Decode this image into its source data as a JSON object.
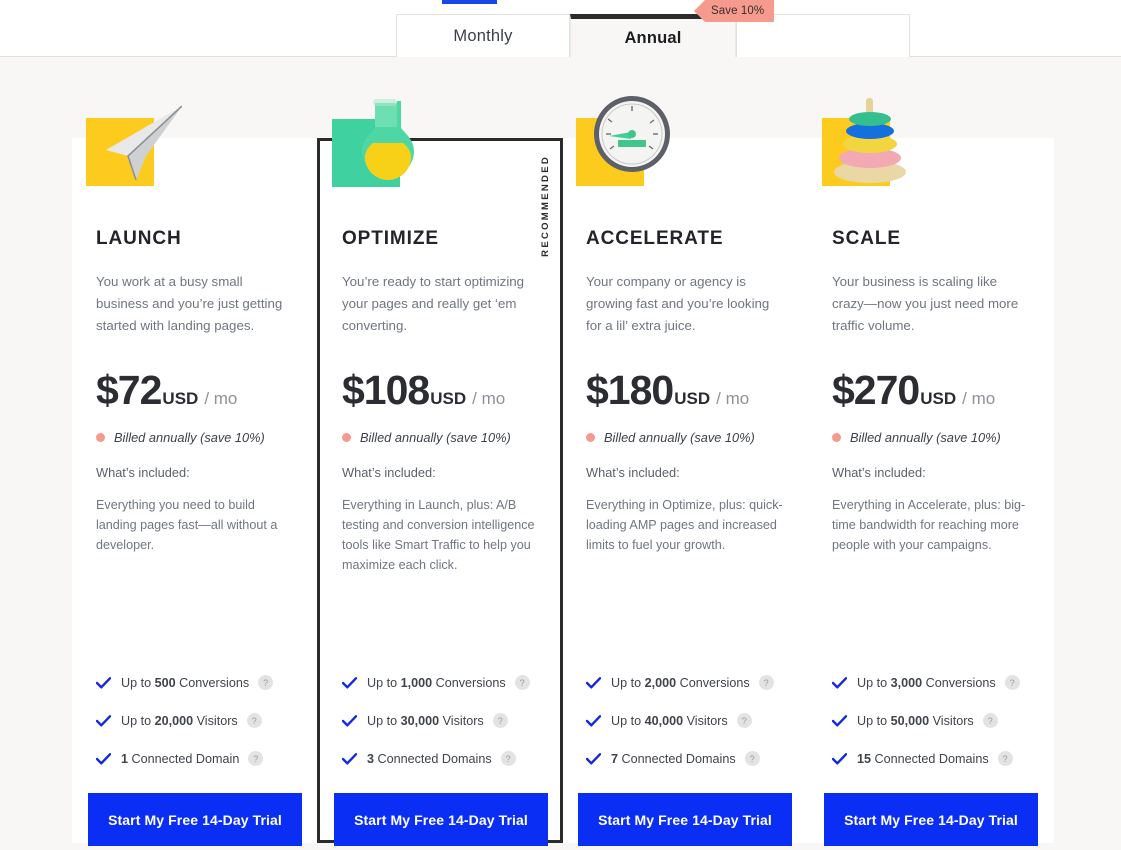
{
  "billing_tabs": {
    "monthly_label": "Monthly",
    "annual_label": "Annual",
    "active": "Annual",
    "save_badge": "Save 10%",
    "accent_blue": "#1447e6",
    "badge_color": "#f79a8e"
  },
  "plans": [
    {
      "name": "LAUNCH",
      "icon": "paper-plane-icon",
      "swatch_color": "#fdcb1e",
      "recommended": "",
      "description": "You work at a busy small business and you’re just getting started with landing pages.",
      "price_amount": "$72",
      "price_currency": "USD",
      "price_period": "/ mo",
      "billed_note": "Billed annually (save 10%)",
      "included_label": "What’s included:",
      "included_text": "Everything you need to build landing pages fast—all without a developer.",
      "features": [
        {
          "prefix": "Up to ",
          "value": "500",
          "suffix": " Conversions",
          "help": "?"
        },
        {
          "prefix": "Up to ",
          "value": "20,000",
          "suffix": " Visitors",
          "help": "?"
        },
        {
          "prefix": "",
          "value": "1",
          "suffix": " Connected Domain",
          "help": "?"
        }
      ],
      "cta_label": "Start My Free 14-Day Trial"
    },
    {
      "name": "OPTIMIZE",
      "icon": "flask-icon",
      "swatch_color": "#3fd2a0",
      "recommended": "RECOMMENDED",
      "description": "You’re ready to start optimizing your pages and really get ‘em converting.",
      "price_amount": "$108",
      "price_currency": "USD",
      "price_period": "/ mo",
      "billed_note": "Billed annually (save 10%)",
      "included_label": "What’s included:",
      "included_text": "Everything in Launch, plus: A/B testing and conversion intelligence tools like Smart Traffic to help you maximize each click.",
      "features": [
        {
          "prefix": "Up to ",
          "value": "1,000",
          "suffix": " Conversions",
          "help": "?"
        },
        {
          "prefix": "Up to ",
          "value": "30,000",
          "suffix": " Visitors",
          "help": "?"
        },
        {
          "prefix": "",
          "value": "3",
          "suffix": " Connected Domains",
          "help": "?"
        }
      ],
      "cta_label": "Start My Free 14-Day Trial"
    },
    {
      "name": "ACCELERATE",
      "icon": "speedometer-icon",
      "swatch_color": "#fdcb1e",
      "recommended": "",
      "description": "Your company or agency is growing fast and you’re looking for a lil’ extra juice.",
      "price_amount": "$180",
      "price_currency": "USD",
      "price_period": "/ mo",
      "billed_note": "Billed annually (save 10%)",
      "included_label": "What’s included:",
      "included_text": "Everything in Optimize, plus: quick-loading AMP pages and increased limits to fuel your growth.",
      "features": [
        {
          "prefix": "Up to ",
          "value": "2,000",
          "suffix": " Conversions",
          "help": "?"
        },
        {
          "prefix": "Up to ",
          "value": "40,000",
          "suffix": " Visitors",
          "help": "?"
        },
        {
          "prefix": "",
          "value": "7",
          "suffix": " Connected Domains",
          "help": "?"
        }
      ],
      "cta_label": "Start My Free 14-Day Trial"
    },
    {
      "name": "SCALE",
      "icon": "stacking-rings-icon",
      "swatch_color": "#fdcb1e",
      "recommended": "",
      "description": "Your business is scaling like crazy—now you just need more traffic volume.",
      "price_amount": "$270",
      "price_currency": "USD",
      "price_period": "/ mo",
      "billed_note": "Billed annually (save 10%)",
      "included_label": "What’s included:",
      "included_text": "Everything in Accelerate, plus: big-time bandwidth for reaching more people with your campaigns.",
      "features": [
        {
          "prefix": "Up to ",
          "value": "3,000",
          "suffix": " Conversions",
          "help": "?"
        },
        {
          "prefix": "Up to ",
          "value": "50,000",
          "suffix": " Visitors",
          "help": "?"
        },
        {
          "prefix": "",
          "value": "15",
          "suffix": " Connected Domains",
          "help": "?"
        }
      ],
      "cta_label": "Start My Free 14-Day Trial"
    }
  ]
}
